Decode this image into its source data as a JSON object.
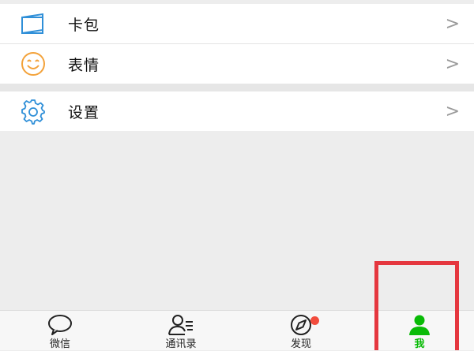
{
  "menu": {
    "items": [
      {
        "label": "卡包",
        "icon": "card-wallet-icon",
        "chevron": ">"
      },
      {
        "label": "表情",
        "icon": "emoji-icon",
        "chevron": ">"
      },
      {
        "label": "设置",
        "icon": "gear-icon",
        "chevron": ">"
      }
    ]
  },
  "tabbar": {
    "tabs": [
      {
        "label": "微信",
        "icon": "chat-bubble-icon",
        "active": false
      },
      {
        "label": "通讯录",
        "icon": "contacts-icon",
        "active": false
      },
      {
        "label": "发现",
        "icon": "compass-icon",
        "active": false,
        "badge": true
      },
      {
        "label": "我",
        "icon": "person-icon",
        "active": true
      }
    ]
  },
  "colors": {
    "accent_green": "#09bb07",
    "icon_blue": "#2f8fd8",
    "icon_orange": "#f3a23a",
    "badge_red": "#f24c3d",
    "highlight_red": "#e5373f"
  }
}
